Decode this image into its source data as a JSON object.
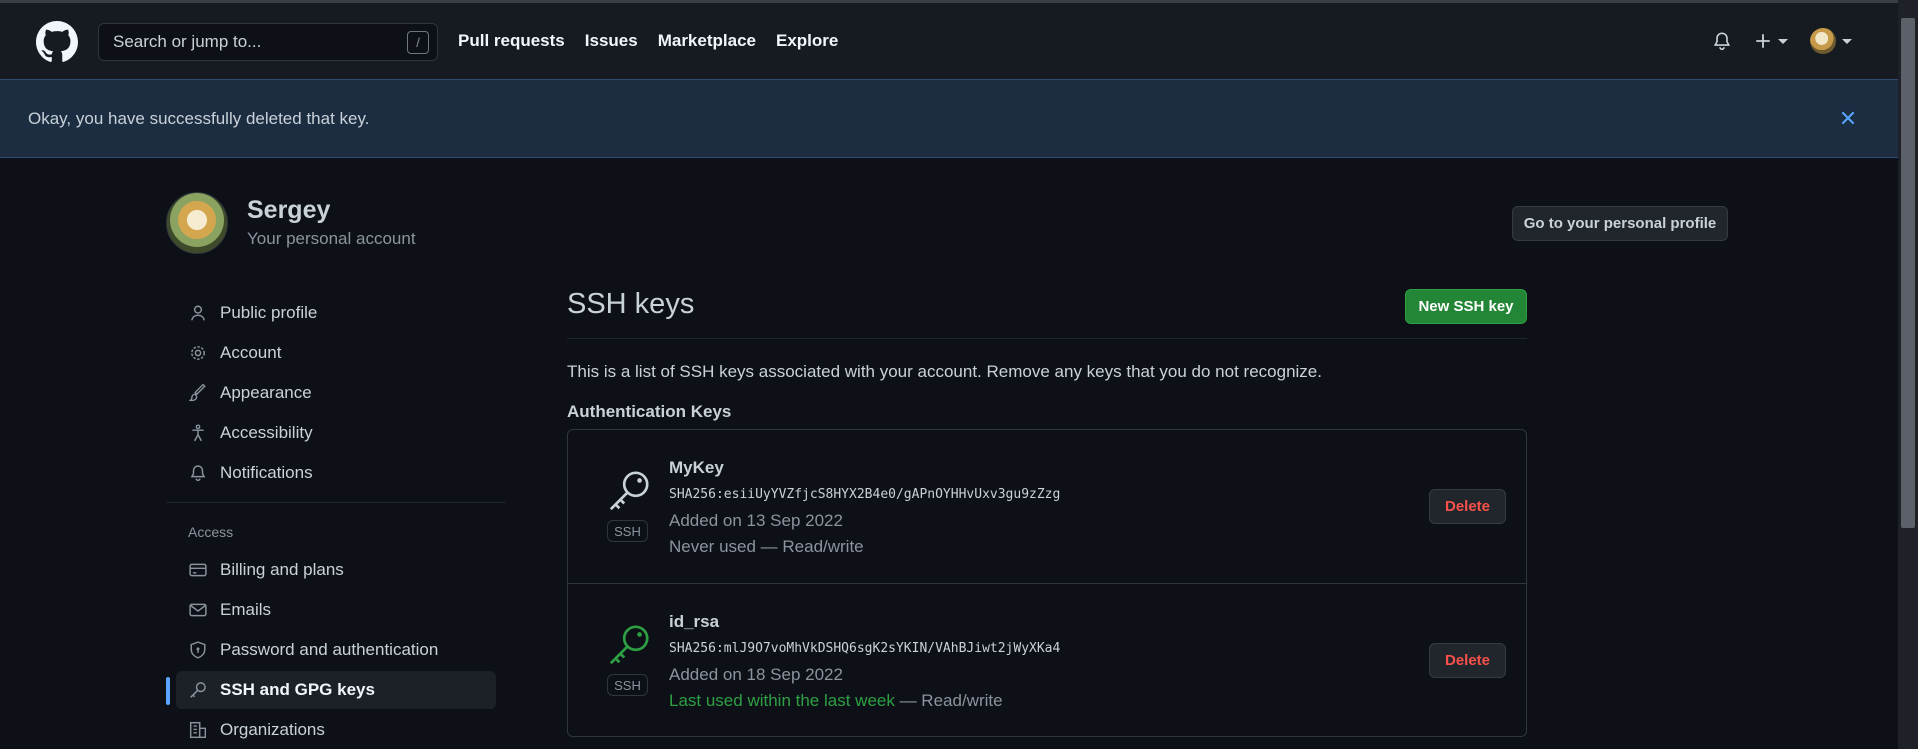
{
  "header": {
    "search_placeholder": "Search or jump to...",
    "search_shortcut": "/",
    "nav": [
      "Pull requests",
      "Issues",
      "Marketplace",
      "Explore"
    ]
  },
  "flash": {
    "message": "Okay, you have successfully deleted that key."
  },
  "account": {
    "name": "Sergey",
    "subtitle": "Your personal account",
    "profile_button": "Go to your personal profile"
  },
  "sidebar": {
    "items": [
      {
        "label": "Public profile",
        "icon": "person-icon"
      },
      {
        "label": "Account",
        "icon": "gear-icon"
      },
      {
        "label": "Appearance",
        "icon": "paintbrush-icon"
      },
      {
        "label": "Accessibility",
        "icon": "accessibility-icon"
      },
      {
        "label": "Notifications",
        "icon": "bell-icon"
      }
    ],
    "access_heading": "Access",
    "access_items": [
      {
        "label": "Billing and plans",
        "icon": "credit-card-icon"
      },
      {
        "label": "Emails",
        "icon": "mail-icon"
      },
      {
        "label": "Password and authentication",
        "icon": "shield-lock-icon"
      },
      {
        "label": "SSH and GPG keys",
        "icon": "key-icon",
        "active": true
      },
      {
        "label": "Organizations",
        "icon": "organization-icon"
      }
    ]
  },
  "main": {
    "title": "SSH keys",
    "new_button": "New SSH key",
    "intro": "This is a list of SSH keys associated with your account. Remove any keys that you do not recognize.",
    "auth_heading": "Authentication Keys",
    "keys": [
      {
        "name": "MyKey",
        "fingerprint": "SHA256:esiiUyYVZfjcS8HYX2B4e0/gAPnOYHHvUxv3gu9zZzg",
        "added": "Added on 13 Sep 2022",
        "usage_highlight": "",
        "usage": "Never used — Read/write",
        "badge": "SSH",
        "delete_label": "Delete",
        "icon_color": "#c9d1d9"
      },
      {
        "name": "id_rsa",
        "fingerprint": "SHA256:mlJ9O7voMhVkDSHQ6sgK2sYKIN/VAhBJiwt2jWyXKa4",
        "added": "Added on 18 Sep 2022",
        "usage_highlight": "Last used within the last week",
        "usage": " — Read/write",
        "badge": "SSH",
        "delete_label": "Delete",
        "icon_color": "#2ea043"
      }
    ]
  }
}
